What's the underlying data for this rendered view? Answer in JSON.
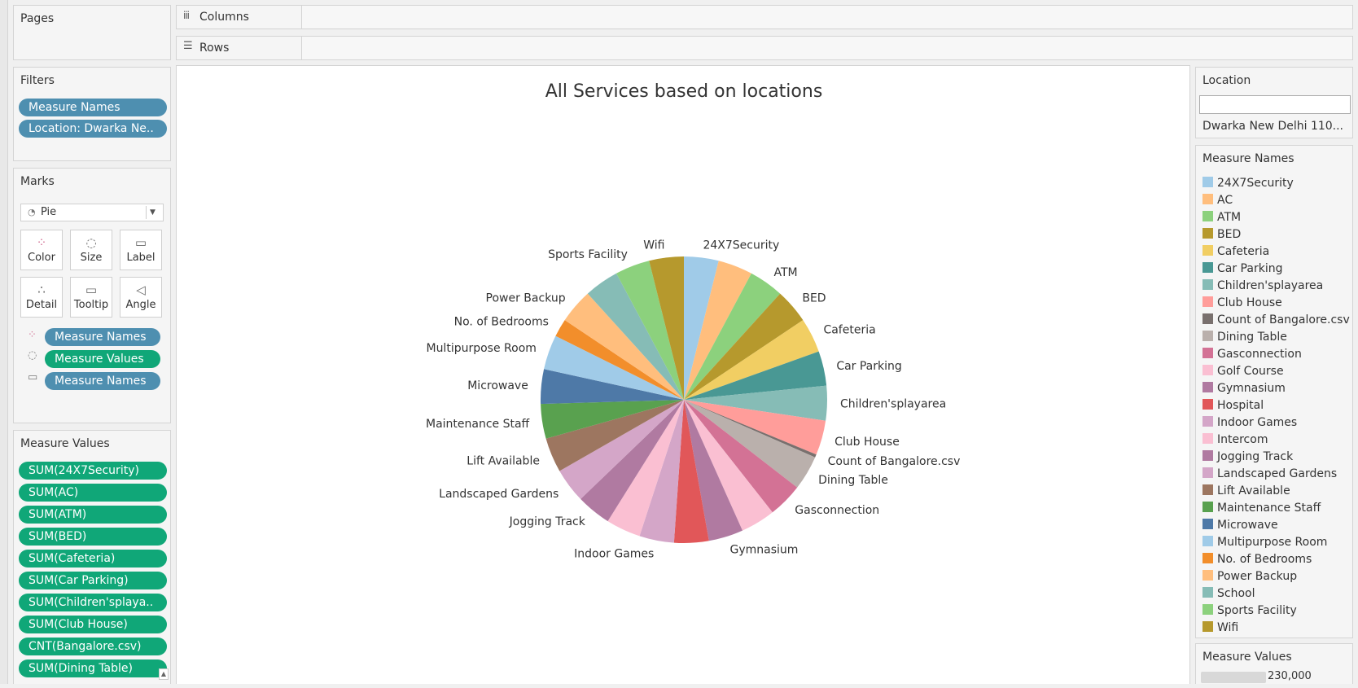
{
  "shelves": {
    "pages": "Pages",
    "columns": "Columns",
    "rows": "Rows"
  },
  "filters": {
    "title": "Filters",
    "items": [
      "Measure Names",
      "Location: Dwarka Ne.."
    ]
  },
  "marks": {
    "title": "Marks",
    "type": "Pie",
    "buttons": [
      "Color",
      "Size",
      "Label",
      "Detail",
      "Tooltip",
      "Angle"
    ],
    "pills": [
      "Measure Names",
      "Measure Values",
      "Measure Names"
    ]
  },
  "measure_values": {
    "title": "Measure Values",
    "items": [
      "SUM(24X7Security)",
      "SUM(AC)",
      "SUM(ATM)",
      "SUM(BED)",
      "SUM(Cafeteria)",
      "SUM(Car Parking)",
      "SUM(Children'splaya..",
      "SUM(Club House)",
      "CNT(Bangalore.csv)",
      "SUM(Dining Table)"
    ]
  },
  "location_filter": {
    "title": "Location",
    "value": "Dwarka New Delhi 110..."
  },
  "legend": {
    "title": "Measure Names",
    "items": [
      {
        "label": "24X7Security",
        "color": "#a0cbe8"
      },
      {
        "label": "AC",
        "color": "#ffbe7d"
      },
      {
        "label": "ATM",
        "color": "#8cd17d"
      },
      {
        "label": "BED",
        "color": "#b6992d"
      },
      {
        "label": "Cafeteria",
        "color": "#f1ce63"
      },
      {
        "label": "Car Parking",
        "color": "#499894"
      },
      {
        "label": "Children'splayarea",
        "color": "#86bcb6"
      },
      {
        "label": "Club House",
        "color": "#ff9d9a"
      },
      {
        "label": "Count of Bangalore.csv",
        "color": "#79706e"
      },
      {
        "label": "Dining Table",
        "color": "#bab0ac"
      },
      {
        "label": "Gasconnection",
        "color": "#d37295"
      },
      {
        "label": "Golf Course",
        "color": "#fabfd2"
      },
      {
        "label": "Gymnasium",
        "color": "#b07aa1"
      },
      {
        "label": "Hospital",
        "color": "#e15759"
      },
      {
        "label": "Indoor Games",
        "color": "#d4a6c8"
      },
      {
        "label": "Intercom",
        "color": "#fabfd2"
      },
      {
        "label": "Jogging Track",
        "color": "#b07aa1"
      },
      {
        "label": "Landscaped Gardens",
        "color": "#d4a6c8"
      },
      {
        "label": "Lift Available",
        "color": "#9d7660"
      },
      {
        "label": "Maintenance Staff",
        "color": "#59a14f"
      },
      {
        "label": "Microwave",
        "color": "#4e79a7"
      },
      {
        "label": "Multipurpose Room",
        "color": "#a0cbe8"
      },
      {
        "label": "No. of Bedrooms",
        "color": "#f28e2b"
      },
      {
        "label": "Power Backup",
        "color": "#ffbe7d"
      },
      {
        "label": "School",
        "color": "#86bcb6"
      },
      {
        "label": "Sports Facility",
        "color": "#8cd17d"
      },
      {
        "label": "Wifi",
        "color": "#b6992d"
      }
    ]
  },
  "size_legend": {
    "title": "Measure Values",
    "value": "230,000"
  },
  "chart_data": {
    "type": "pie",
    "title": "All Services based on locations",
    "slices": [
      {
        "label": "24X7Security",
        "value": 23,
        "color": "#a0cbe8",
        "show_label": true
      },
      {
        "label": "AC",
        "value": 23,
        "color": "#ffbe7d",
        "show_label": false
      },
      {
        "label": "ATM",
        "value": 23,
        "color": "#8cd17d",
        "show_label": true
      },
      {
        "label": "BED",
        "value": 23,
        "color": "#b6992d",
        "show_label": true
      },
      {
        "label": "Cafeteria",
        "value": 23,
        "color": "#f1ce63",
        "show_label": true
      },
      {
        "label": "Car Parking",
        "value": 23,
        "color": "#499894",
        "show_label": true
      },
      {
        "label": "Children'splayarea",
        "value": 23,
        "color": "#86bcb6",
        "show_label": true
      },
      {
        "label": "Club House",
        "value": 23,
        "color": "#ff9d9a",
        "show_label": true
      },
      {
        "label": "Count of Bangalore.csv",
        "value": 2,
        "color": "#79706e",
        "show_label": true
      },
      {
        "label": "Dining Table",
        "value": 23,
        "color": "#bab0ac",
        "show_label": true
      },
      {
        "label": "Gasconnection",
        "value": 23,
        "color": "#d37295",
        "show_label": true
      },
      {
        "label": "Golf Course",
        "value": 23,
        "color": "#fabfd2",
        "show_label": false
      },
      {
        "label": "Gymnasium",
        "value": 23,
        "color": "#b07aa1",
        "show_label": true
      },
      {
        "label": "Hospital",
        "value": 23,
        "color": "#e15759",
        "show_label": false
      },
      {
        "label": "Indoor Games",
        "value": 23,
        "color": "#d4a6c8",
        "show_label": true
      },
      {
        "label": "Intercom",
        "value": 23,
        "color": "#fabfd2",
        "show_label": false
      },
      {
        "label": "Jogging Track",
        "value": 23,
        "color": "#b07aa1",
        "show_label": true
      },
      {
        "label": "Landscaped Gardens",
        "value": 23,
        "color": "#d4a6c8",
        "show_label": true
      },
      {
        "label": "Lift Available",
        "value": 23,
        "color": "#9d7660",
        "show_label": true
      },
      {
        "label": "Maintenance Staff",
        "value": 23,
        "color": "#59a14f",
        "show_label": true
      },
      {
        "label": "Microwave",
        "value": 23,
        "color": "#4e79a7",
        "show_label": true
      },
      {
        "label": "Multipurpose Room",
        "value": 23,
        "color": "#a0cbe8",
        "show_label": true
      },
      {
        "label": "No. of Bedrooms",
        "value": 12,
        "color": "#f28e2b",
        "show_label": true
      },
      {
        "label": "Power Backup",
        "value": 23,
        "color": "#ffbe7d",
        "show_label": true
      },
      {
        "label": "School",
        "value": 23,
        "color": "#86bcb6",
        "show_label": false
      },
      {
        "label": "Sports Facility",
        "value": 23,
        "color": "#8cd17d",
        "show_label": true
      },
      {
        "label": "Wifi",
        "value": 23,
        "color": "#b6992d",
        "show_label": true
      }
    ]
  }
}
